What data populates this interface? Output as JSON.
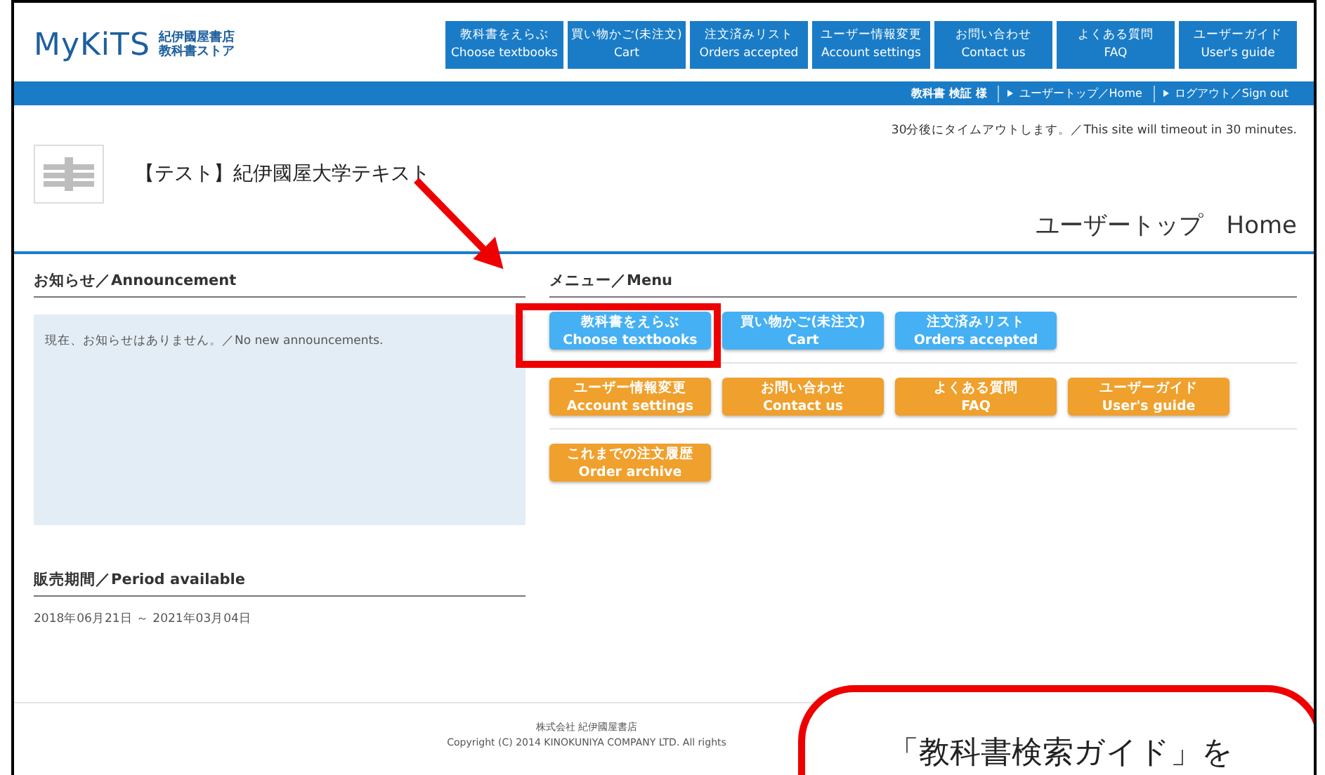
{
  "header": {
    "brand": "MyKiTS",
    "brand_sub": [
      "紀伊國屋書店",
      "教科書ストア"
    ],
    "nav": [
      {
        "ja": "教科書をえらぶ",
        "en": "Choose textbooks"
      },
      {
        "ja": "買い物かご(未注文)",
        "en": "Cart"
      },
      {
        "ja": "注文済みリスト",
        "en": "Orders accepted"
      },
      {
        "ja": "ユーザー情報変更",
        "en": "Account settings"
      },
      {
        "ja": "お問い合わせ",
        "en": "Contact us"
      },
      {
        "ja": "よくある質問",
        "en": "FAQ"
      },
      {
        "ja": "ユーザーガイド",
        "en": "User's guide"
      }
    ]
  },
  "user_bar": {
    "user": "教科書 検証 様",
    "links": [
      "ユーザートップ／Home",
      "ログアウト／Sign out"
    ]
  },
  "timeout_notice": "30分後にタイムアウトします。／This site will timeout in 30 minutes.",
  "school_name": "【テスト】紀伊國屋大学テキスト",
  "page_title": "ユーザートップ　Home",
  "announcement": {
    "heading": "お知らせ／Announcement",
    "message": "現在、お知らせはありません。／No new announcements."
  },
  "period": {
    "heading": "販売期間／Period available",
    "dates": "2018年06月21日 ～ 2021年03月04日"
  },
  "menu": {
    "heading": "メニュー／Menu",
    "rows": [
      [
        {
          "ja": "教科書をえらぶ",
          "en": "Choose textbooks",
          "color": "#45b0f3"
        },
        {
          "ja": "買い物かご(未注文)",
          "en": "Cart",
          "color": "#45b0f3"
        },
        {
          "ja": "注文済みリスト",
          "en": "Orders accepted",
          "color": "#45b0f3"
        }
      ],
      [
        {
          "ja": "ユーザー情報変更",
          "en": "Account settings",
          "color": "#f0a02c"
        },
        {
          "ja": "お問い合わせ",
          "en": "Contact us",
          "color": "#f0a02c"
        },
        {
          "ja": "よくある質問",
          "en": "FAQ",
          "color": "#f0a02c"
        },
        {
          "ja": "ユーザーガイド",
          "en": "User's guide",
          "color": "#f0a02c"
        }
      ],
      [
        {
          "ja": "これまでの注文履歴",
          "en": "Order archive",
          "color": "#f0a02c"
        }
      ]
    ]
  },
  "footer": [
    "株式会社 紀伊國屋書店",
    "Copyright (C) 2014 KINOKUNIYA COMPANY LTD. All rights"
  ],
  "callout": "「教科書検索ガイド」を"
}
